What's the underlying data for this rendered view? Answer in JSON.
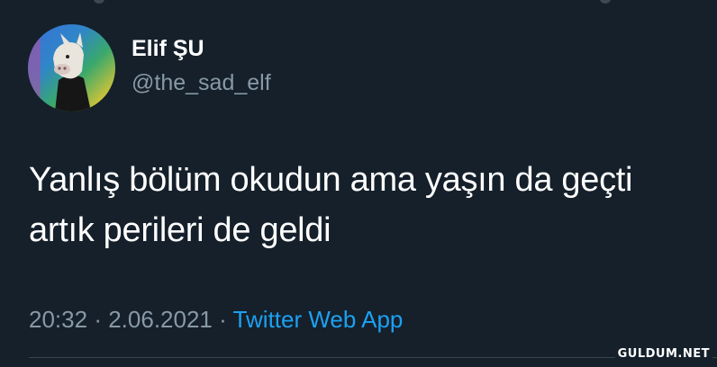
{
  "tweet": {
    "author": {
      "display_name": "Elif ŞU",
      "handle": "@the_sad_elf",
      "avatar": "profile-photo-icon"
    },
    "text_lines": [
      "Yanlış bölüm okudun ama yaşın da geçti",
      "artık perileri de geldi"
    ],
    "time": "20:32",
    "separator": "·",
    "date": "2.06.2021",
    "source": "Twitter Web App"
  },
  "watermark": "GULDUM.NET",
  "colors": {
    "background": "#15202b",
    "text": "#ffffff",
    "secondary_text": "#8899a6",
    "link": "#1da1f2",
    "divider": "#38444d"
  }
}
